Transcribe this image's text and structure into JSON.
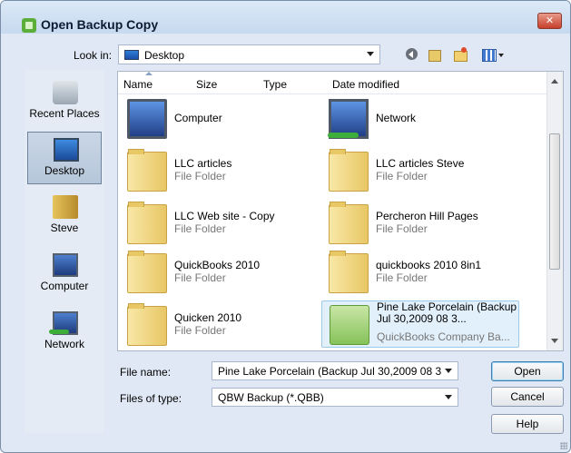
{
  "dialog": {
    "title": "Open Backup Copy",
    "close_label": "✕"
  },
  "lookin": {
    "label": "Look in:",
    "value": "Desktop"
  },
  "places": [
    {
      "label": "Recent Places",
      "icon": "recent-places-icon"
    },
    {
      "label": "Desktop",
      "icon": "desktop-icon",
      "selected": true
    },
    {
      "label": "Steve",
      "icon": "user-folder-icon"
    },
    {
      "label": "Computer",
      "icon": "computer-icon"
    },
    {
      "label": "Network",
      "icon": "network-icon"
    }
  ],
  "columns": {
    "name": "Name",
    "size": "Size",
    "type": "Type",
    "date": "Date modified"
  },
  "items": [
    {
      "name": "Computer",
      "type": ""
    },
    {
      "name": "Network",
      "type": ""
    },
    {
      "name": "LLC articles",
      "type": "File Folder"
    },
    {
      "name": "LLC articles Steve",
      "type": "File Folder"
    },
    {
      "name": "LLC Web site - Copy",
      "type": "File Folder"
    },
    {
      "name": "Percheron Hill Pages",
      "type": "File Folder"
    },
    {
      "name": "QuickBooks 2010",
      "type": "File Folder"
    },
    {
      "name": "quickbooks 2010 8in1",
      "type": "File Folder"
    },
    {
      "name": "Quicken 2010",
      "type": "File Folder"
    },
    {
      "name": "Pine Lake Porcelain (Backup Jul 30,2009  08 3...",
      "type": "QuickBooks Company Ba..."
    }
  ],
  "filename": {
    "label": "File name:",
    "value": "Pine Lake Porcelain (Backup Jul 30,2009  08 3"
  },
  "filetype": {
    "label": "Files of type:",
    "value": "QBW Backup (*.QBB)"
  },
  "buttons": {
    "open": "Open",
    "cancel": "Cancel",
    "help": "Help"
  },
  "colors": {
    "title_bar": "#c6d9ef",
    "selection": "#e2f0fb",
    "close_button": "#c6402a"
  }
}
